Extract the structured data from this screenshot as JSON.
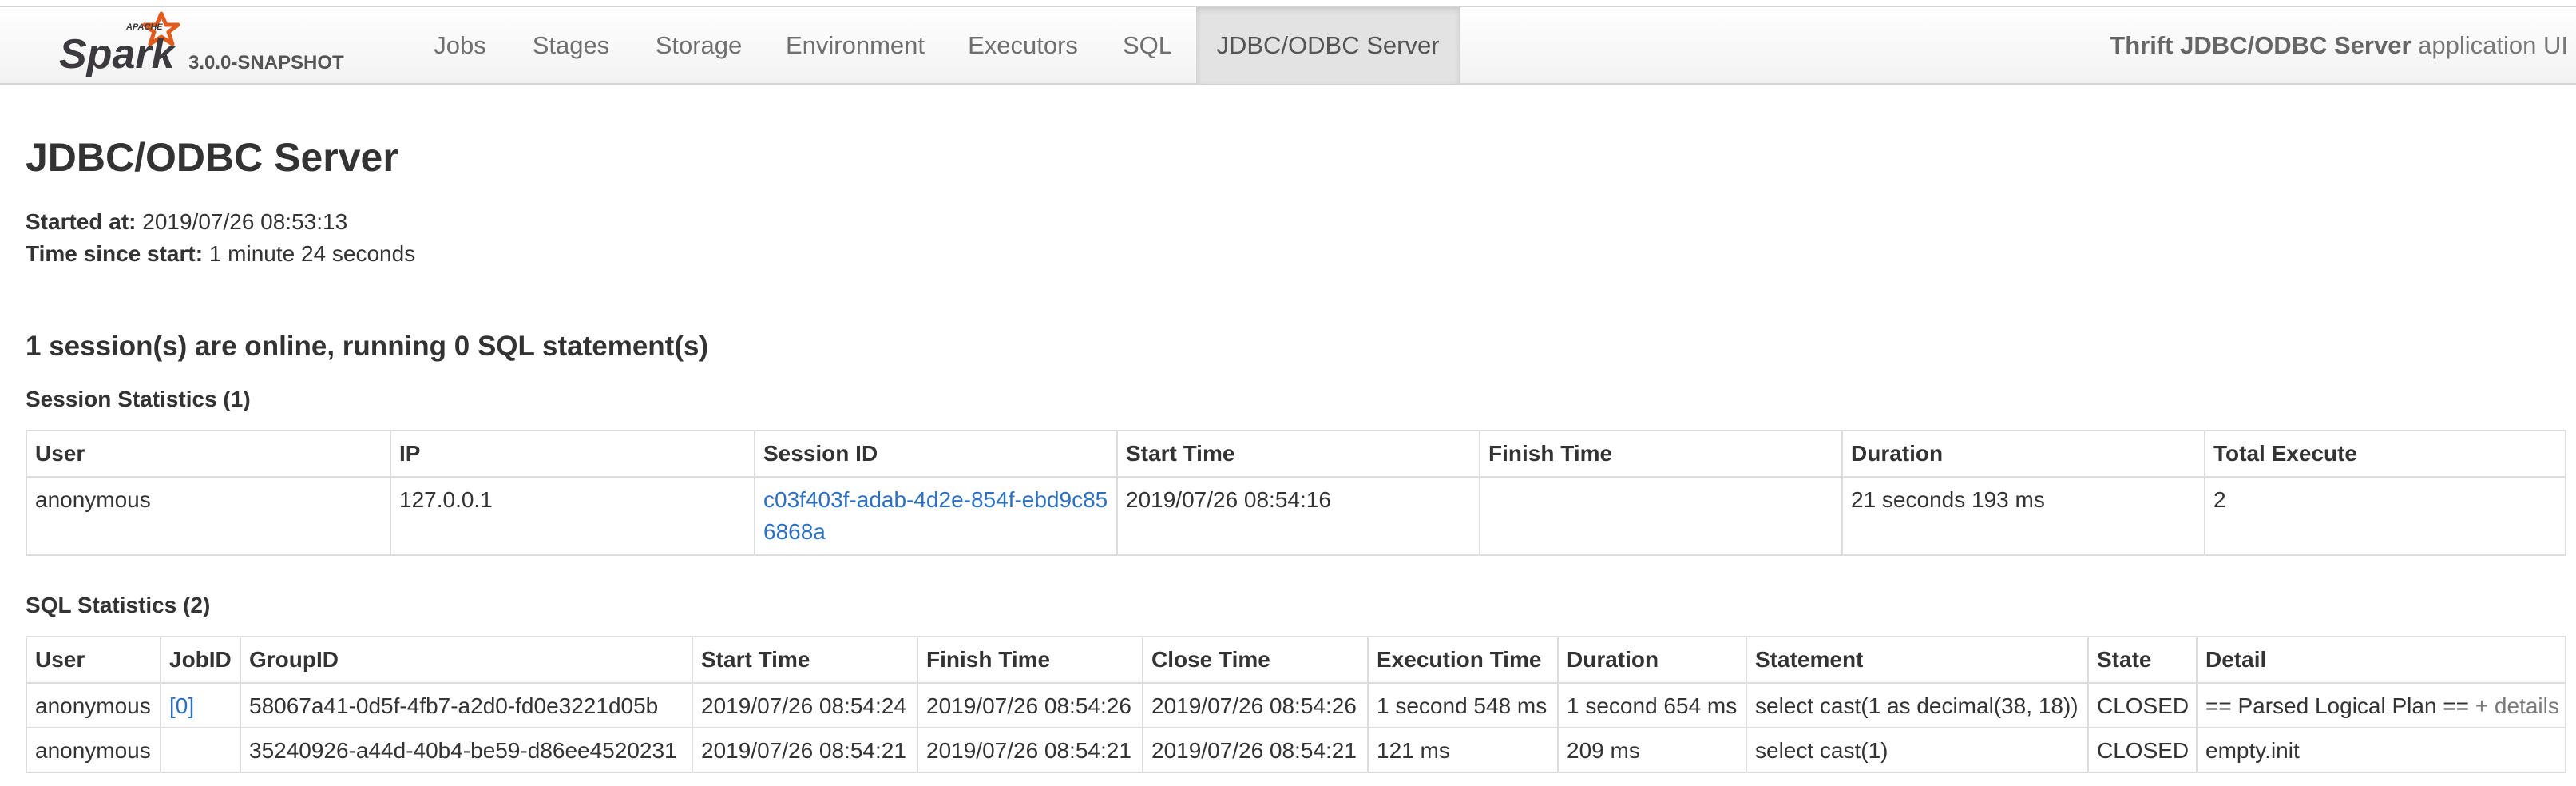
{
  "navbar": {
    "logo_text": "Spark",
    "logo_super": "APACHE",
    "version": "3.0.0-SNAPSHOT",
    "tabs": [
      {
        "label": "Jobs"
      },
      {
        "label": "Stages"
      },
      {
        "label": "Storage"
      },
      {
        "label": "Environment"
      },
      {
        "label": "Executors"
      },
      {
        "label": "SQL"
      },
      {
        "label": "JDBC/ODBC Server",
        "active": true
      }
    ],
    "app_title_bold": "Thrift JDBC/ODBC Server",
    "app_title_rest": " application UI"
  },
  "page": {
    "title": "JDBC/ODBC Server",
    "started_label": "Started at:",
    "started_value": "2019/07/26 08:53:13",
    "since_label": "Time since start:",
    "since_value": "1 minute 24 seconds",
    "summary": "1 session(s) are online, running 0 SQL statement(s)"
  },
  "session_stats": {
    "heading": "Session Statistics (1)",
    "columns": [
      "User",
      "IP",
      "Session ID",
      "Start Time",
      "Finish Time",
      "Duration",
      "Total Execute"
    ],
    "rows": [
      {
        "user": "anonymous",
        "ip": "127.0.0.1",
        "session_id": "c03f403f-adab-4d2e-854f-ebd9c856868a",
        "start_time": "2019/07/26 08:54:16",
        "finish_time": "",
        "duration": "21 seconds 193 ms",
        "total_execute": "2"
      }
    ]
  },
  "sql_stats": {
    "heading": "SQL Statistics (2)",
    "columns": [
      "User",
      "JobID",
      "GroupID",
      "Start Time",
      "Finish Time",
      "Close Time",
      "Execution Time",
      "Duration",
      "Statement",
      "State",
      "Detail"
    ],
    "rows": [
      {
        "user": "anonymous",
        "job_id": "[0]",
        "group_id": "58067a41-0d5f-4fb7-a2d0-fd0e3221d05b",
        "start_time": "2019/07/26 08:54:24",
        "finish_time": "2019/07/26 08:54:26",
        "close_time": "2019/07/26 08:54:26",
        "execution_time": "1 second 548 ms",
        "duration": "1 second 654 ms",
        "statement": "select cast(1 as decimal(38, 18))",
        "state": "CLOSED",
        "detail": "== Parsed Logical Plan ==",
        "detail_link": "+ details"
      },
      {
        "user": "anonymous",
        "job_id": "",
        "group_id": "35240926-a44d-40b4-be59-d86ee4520231",
        "start_time": "2019/07/26 08:54:21",
        "finish_time": "2019/07/26 08:54:21",
        "close_time": "2019/07/26 08:54:21",
        "execution_time": "121 ms",
        "duration": "209 ms",
        "statement": "select cast(1)",
        "state": "CLOSED",
        "detail": "empty.init",
        "detail_link": ""
      }
    ]
  },
  "colors": {
    "link": "#2b70c2",
    "logo_orange": "#e25a1c",
    "logo_text": "#3c3a3e",
    "active_tab_bg": "#e3e3e3"
  }
}
